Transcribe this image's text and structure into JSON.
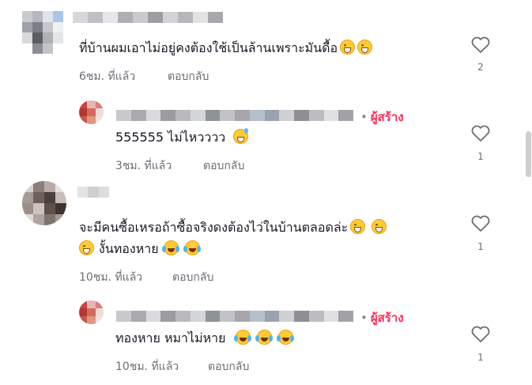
{
  "comments": [
    {
      "text": "ที่บ้านผมเอาไม่อยู่คงต้องใช้เป็นล้านเพราะมันดื้อ",
      "emojis": [
        "grinning-face-with-smiling-eyes",
        "grinning-face-with-smiling-eyes"
      ],
      "time": "6ชม. ที่แล้ว",
      "reply_label": "ตอบกลับ",
      "likes": "2"
    },
    {
      "text": "555555 ไม่ไหวววว",
      "emojis": [
        "grinning-face-with-sweat"
      ],
      "creator_badge": "ผู้สร้าง",
      "time": "3ชม. ที่แล้ว",
      "reply_label": "ตอบกลับ",
      "likes": "1"
    },
    {
      "text_line1": "จะมีคนซื้อเหรอถ้าซื้อจริงดงต้องไว่ในบ้านตลอดล่ะ",
      "text_line2": "งั้นทองหาย",
      "emojis_line1": [
        "grinning-face-with-smiling-eyes",
        "grinning-face-with-smiling-eyes"
      ],
      "emojis_line2": [
        "grinning-face-with-smiling-eyes",
        "face-with-tears-of-joy",
        "face-with-tears-of-joy"
      ],
      "time": "10ชม. ที่แล้ว",
      "reply_label": "ตอบกลับ",
      "likes": "1"
    },
    {
      "text": "ทองหาย หมาไม่หาย",
      "emojis": [
        "face-with-tears-of-joy",
        "face-with-tears-of-joy",
        "face-with-tears-of-joy"
      ],
      "creator_badge": "ผู้สร้าง",
      "time": "10ชม. ที่แล้ว",
      "reply_label": "ตอบกลับ",
      "likes": "1"
    }
  ],
  "icons": {
    "like": "heart-outline-icon"
  },
  "colors": {
    "creator": "#fe2c55",
    "text": "#161823",
    "meta": "#6b6d75"
  }
}
